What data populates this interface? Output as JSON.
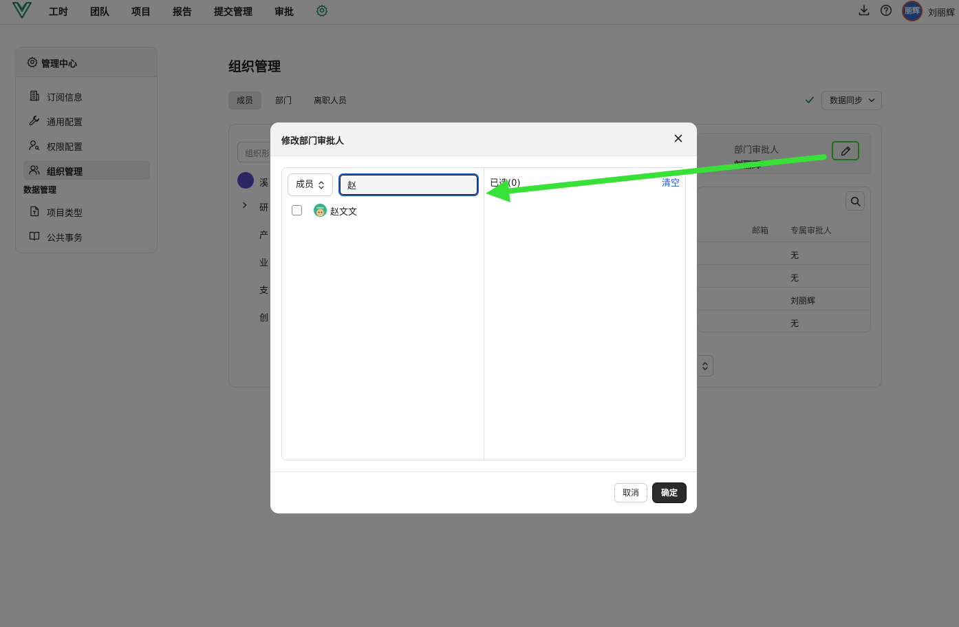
{
  "topbar": {
    "nav": [
      "工时",
      "团队",
      "项目",
      "报告",
      "提交管理",
      "审批"
    ],
    "avatar_text": "丽辉",
    "user_name": "刘丽辉"
  },
  "sidebar": {
    "header": "管理中心",
    "items": [
      {
        "label": "订阅信息",
        "icon": "building-icon"
      },
      {
        "label": "通用配置",
        "icon": "wrench-icon"
      },
      {
        "label": "权限配置",
        "icon": "user-key-icon"
      },
      {
        "label": "组织管理",
        "icon": "users-icon",
        "active": true
      }
    ],
    "section": "数据管理",
    "section_items": [
      {
        "label": "项目类型",
        "icon": "file-type-icon"
      },
      {
        "label": "公共事务",
        "icon": "book-icon"
      }
    ]
  },
  "main": {
    "title": "组织管理",
    "tabs": [
      {
        "label": "成员",
        "active": true
      },
      {
        "label": "部门"
      },
      {
        "label": "离职人员"
      }
    ],
    "sync_button": "数据同步",
    "org_search_placeholder": "组织形",
    "tree": [
      "溪",
      "研",
      "产",
      "业",
      "支",
      "创"
    ],
    "dept_approver_label": "部门审批人",
    "dept_approver_value": "刘丽辉",
    "table": {
      "headers": [
        "邮箱",
        "专属审批人"
      ],
      "approvers": [
        "无",
        "无",
        "刘丽辉",
        "无"
      ]
    }
  },
  "modal": {
    "title": "修改部门审批人",
    "type_select": "成员",
    "search_value": "赵",
    "members": [
      {
        "name": "赵文文",
        "checked": false
      }
    ],
    "selected_label": "已选(0)",
    "clear_label": "清空",
    "cancel_label": "取消",
    "ok_label": "确定"
  },
  "colors": {
    "accent": "#1a56d6",
    "annotation": "#38e038",
    "primary_button": "#2b2b2b"
  }
}
